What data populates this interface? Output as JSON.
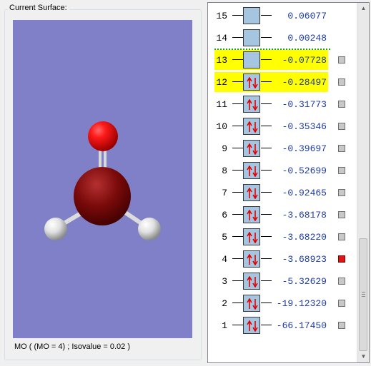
{
  "surface_panel": {
    "label": "Current Surface:",
    "viewer_bg": "#8080c8",
    "status": "MO ( (MO = 4) ; Isovalue = 0.02 )"
  },
  "orbitals": [
    {
      "num": "15",
      "energy": "0.06077",
      "occupied": false,
      "highlighted": false,
      "selected": false
    },
    {
      "num": "14",
      "energy": "0.00248",
      "occupied": false,
      "highlighted": false,
      "selected": false
    },
    {
      "num": "13",
      "energy": "-0.07728",
      "occupied": false,
      "highlighted": true,
      "selected": false
    },
    {
      "num": "12",
      "energy": "-0.28497",
      "occupied": true,
      "highlighted": true,
      "selected": false
    },
    {
      "num": "11",
      "energy": "-0.31773",
      "occupied": true,
      "highlighted": false,
      "selected": false
    },
    {
      "num": "10",
      "energy": "-0.35346",
      "occupied": true,
      "highlighted": false,
      "selected": false
    },
    {
      "num": "9",
      "energy": "-0.39697",
      "occupied": true,
      "highlighted": false,
      "selected": false
    },
    {
      "num": "8",
      "energy": "-0.52699",
      "occupied": true,
      "highlighted": false,
      "selected": false
    },
    {
      "num": "7",
      "energy": "-0.92465",
      "occupied": true,
      "highlighted": false,
      "selected": false
    },
    {
      "num": "6",
      "energy": "-3.68178",
      "occupied": true,
      "highlighted": false,
      "selected": false
    },
    {
      "num": "5",
      "energy": "-3.68220",
      "occupied": true,
      "highlighted": false,
      "selected": false
    },
    {
      "num": "4",
      "energy": "-3.68923",
      "occupied": true,
      "highlighted": false,
      "selected": true
    },
    {
      "num": "3",
      "energy": "-5.32629",
      "occupied": true,
      "highlighted": false,
      "selected": false
    },
    {
      "num": "2",
      "energy": "-19.12320",
      "occupied": true,
      "highlighted": false,
      "selected": false
    },
    {
      "num": "1",
      "energy": "-66.17450",
      "occupied": true,
      "highlighted": false,
      "selected": false
    }
  ],
  "colors": {
    "highlight": "#ffff00",
    "energy_text": "#1c3aa6",
    "orbital_box": "#a6c5e0",
    "spin_arrow": "#e00000",
    "selected_marker": "#e01414",
    "homo_lumo_separator": "#1fa81f"
  },
  "icons": {
    "scroll_up": "triangle-up-icon",
    "scroll_down": "triangle-down-icon"
  }
}
